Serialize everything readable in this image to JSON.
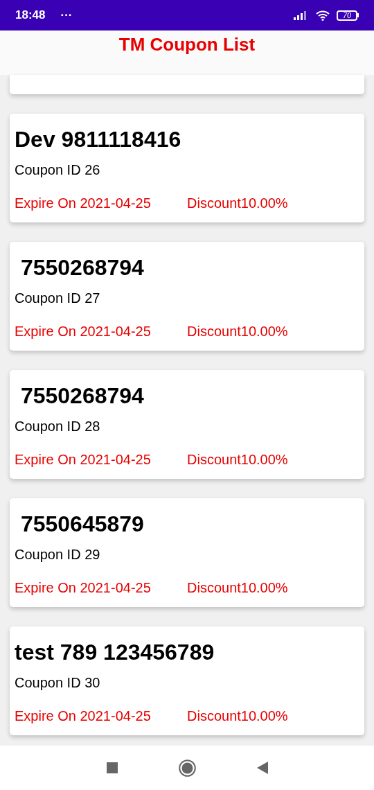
{
  "status_bar": {
    "time": "18:48",
    "dots": "···",
    "battery": "70"
  },
  "header": {
    "title": "TM Coupon List"
  },
  "coupons": [
    {
      "name": "Dev 9811118416",
      "coupon_id": "Coupon ID 26",
      "expire": "Expire On 2021-04-25",
      "discount": "Discount10.00%"
    },
    {
      "name": " 7550268794",
      "coupon_id": "Coupon ID 27",
      "expire": "Expire On 2021-04-25",
      "discount": "Discount10.00%"
    },
    {
      "name": " 7550268794",
      "coupon_id": "Coupon ID 28",
      "expire": "Expire On 2021-04-25",
      "discount": "Discount10.00%"
    },
    {
      "name": " 7550645879",
      "coupon_id": "Coupon ID 29",
      "expire": "Expire On 2021-04-25",
      "discount": "Discount10.00%"
    },
    {
      "name": "test 789 123456789",
      "coupon_id": "Coupon ID 30",
      "expire": "Expire On 2021-04-25",
      "discount": "Discount10.00%"
    }
  ]
}
